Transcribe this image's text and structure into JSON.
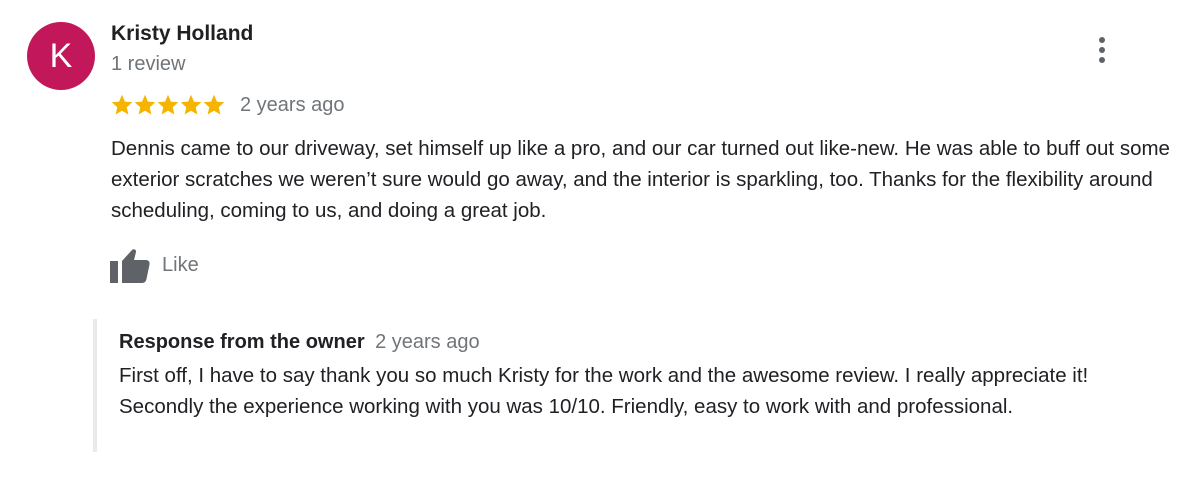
{
  "review": {
    "author": {
      "initial": "K",
      "name": "Kristy Holland",
      "meta": "1 review",
      "avatar_color": "#c2185b"
    },
    "rating": 5,
    "rating_max": 5,
    "star_color": "#f4b400",
    "date": "2 years ago",
    "text": "Dennis came to our driveway, set himself up like a pro, and our car turned out like-new. He was able to buff out some exterior scratches we weren’t sure would go away, and the interior is sparkling, too. Thanks for the flexibility around scheduling, coming to us, and doing a great job.",
    "like_label": "Like",
    "more_icon": "more-vert-icon"
  },
  "owner_response": {
    "title": "Response from the owner",
    "date": "2 years ago",
    "text": "First off, I have to say thank you so much Kristy for the work and the awesome review. I really appreciate it! Secondly the experience working with you was 10/10. Friendly, easy to work with and professional."
  }
}
